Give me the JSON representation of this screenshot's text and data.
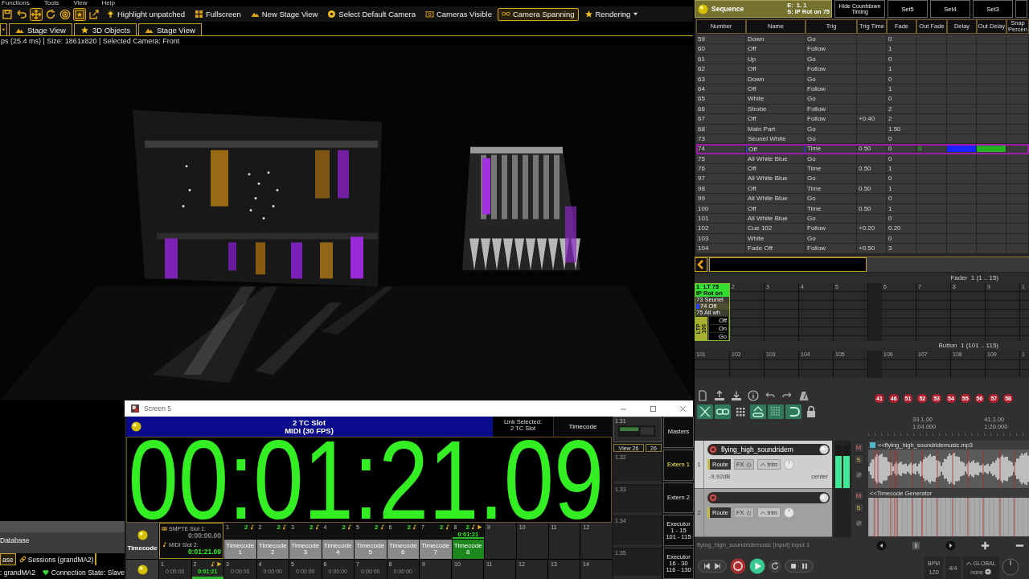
{
  "menu_bar": {
    "items": [
      "Functions",
      "Tools",
      "View",
      "Help"
    ]
  },
  "stage_toolbar": {
    "tools": [
      {
        "kind": "save",
        "selected": false
      },
      {
        "kind": "undo",
        "selected": false
      },
      {
        "kind": "move",
        "selected": true
      },
      {
        "kind": "rotate",
        "selected": false
      },
      {
        "kind": "target",
        "selected": false
      },
      {
        "kind": "star_frame",
        "selected": true
      },
      {
        "kind": "frame_arrow",
        "selected": false
      }
    ],
    "actions": [
      {
        "kind": "bulb",
        "label": "Highlight unpatched",
        "selected": false,
        "dropdown": false
      },
      {
        "kind": "grid",
        "label": "Fullscreen",
        "selected": false,
        "dropdown": false
      },
      {
        "kind": "stage",
        "label": "New Stage View",
        "selected": false,
        "dropdown": false
      },
      {
        "kind": "camera",
        "label": "Select Default Camera",
        "selected": false,
        "dropdown": false
      },
      {
        "kind": "camera_frame",
        "label": "Cameras Visible",
        "selected": false,
        "dropdown": false
      },
      {
        "kind": "glasses",
        "label": "Camera Spanning",
        "selected": true,
        "dropdown": false
      },
      {
        "kind": "star",
        "label": "Rendering",
        "selected": false,
        "dropdown": true
      }
    ]
  },
  "stage_tabs": [
    {
      "kind": "stage",
      "label": "Stage View"
    },
    {
      "kind": "star",
      "label": "3D Objects"
    },
    {
      "kind": "stage",
      "label": "Stage View"
    }
  ],
  "stage_status": "ps (25.4 ms) | Size: 1861x820 | Selected Camera: Front",
  "onpc": {
    "database": "Database",
    "tabs": [
      {
        "label": "ase",
        "selected": true
      },
      {
        "label": "Sessions (grandMA2)",
        "selected": false
      }
    ],
    "session": ": grandMA2",
    "connection": "Connection State: Slave"
  },
  "timecode_window": {
    "title": "Screen 5",
    "slot": "2 TC Slot",
    "format": "MIDI (30 FPS)",
    "link_label": "Link Selected:\n2 TC Slot",
    "view_button": "Timecode",
    "display": "00:01:21.09",
    "preview": {
      "number": "1.31",
      "view": "View 26",
      "view_number": "26"
    },
    "empty_views": [
      "1.32",
      "1.33",
      "1.34",
      "1.35"
    ],
    "side_buttons": [
      {
        "label": "Masters",
        "selected": false
      },
      {
        "label": "Extern 1",
        "selected": true
      },
      {
        "label": "Extern 2",
        "selected": false
      },
      {
        "label": "Executor\n1 - 15\n101 - 115",
        "selected": false
      },
      {
        "label": "Executor\n16 - 30\n116 - 130",
        "selected": false
      }
    ],
    "pool_button": "Timecode",
    "slot_info": [
      {
        "kind": "smpte",
        "label": "SMPTE Slot 1:",
        "value": "0:00:00.00",
        "active": false
      },
      {
        "kind": "midi",
        "label": "MIDI Slot 2:",
        "value": "0:01:21.09",
        "active": true
      }
    ],
    "timecodes": [
      {
        "number": "1",
        "slot": "2",
        "label": "Timecode\n1",
        "selected": false,
        "running": false
      },
      {
        "number": "2",
        "slot": "2",
        "label": "Timecode\n2",
        "selected": false,
        "running": false
      },
      {
        "number": "3",
        "slot": "2",
        "label": "Timecode\n3",
        "selected": false,
        "running": false
      },
      {
        "number": "4",
        "slot": "2",
        "label": "Timecode\n4",
        "selected": false,
        "running": false
      },
      {
        "number": "5",
        "slot": "2",
        "label": "Timecode\n5",
        "selected": false,
        "running": false
      },
      {
        "number": "6",
        "slot": "2",
        "label": "Timecode\n6",
        "selected": false,
        "running": false
      },
      {
        "number": "7",
        "slot": "2",
        "label": "Timecode\n7",
        "selected": false,
        "running": false
      },
      {
        "number": "8",
        "slot": "2",
        "label": "Timecode\n8",
        "selected": true,
        "running": true,
        "time": "0:01:21"
      }
    ],
    "empty_pool": [
      "9",
      "10",
      "11",
      "12"
    ],
    "executor_row": [
      {
        "number": "1",
        "time": "0:00:00",
        "running": false
      },
      {
        "number": "2",
        "time": "0:01:21",
        "running": true
      },
      {
        "number": "3",
        "time": "0:00:00",
        "running": false
      },
      {
        "number": "4",
        "time": "0:00:00",
        "running": false
      },
      {
        "number": "5",
        "time": "0:00:00",
        "running": false
      },
      {
        "number": "6",
        "time": "0:00:00",
        "running": false
      },
      {
        "number": "7",
        "time": "0:00:00",
        "running": false
      },
      {
        "number": "8",
        "time": "0:00:00",
        "running": false
      }
    ],
    "empty_executors": [
      "9",
      "10",
      "11",
      "12",
      "13",
      "14"
    ]
  },
  "sequence": {
    "title": "Sequence",
    "executor": "E:  1. 1",
    "cue": "S: IP Rot on 75",
    "buttons": [
      "Hide Countdown Timing",
      "Set5",
      "Set4",
      "Set3"
    ],
    "columns": [
      "Number",
      "Name",
      "Trig",
      "Trig Time",
      "Fade",
      "Out Fade",
      "Delay",
      "Out Delay",
      "Snap Percen"
    ],
    "rows": [
      {
        "number": "59",
        "name": "Down",
        "trig": "Go",
        "fade": "0",
        "selected": false
      },
      {
        "number": "60",
        "name": "Off",
        "trig": "Follow",
        "fade": "1",
        "selected": false
      },
      {
        "number": "61",
        "name": "Up",
        "trig": "Go",
        "fade": "0",
        "selected": false
      },
      {
        "number": "62",
        "name": "Off",
        "trig": "Follow",
        "fade": "1",
        "selected": false
      },
      {
        "number": "63",
        "name": "Down",
        "trig": "Go",
        "fade": "0",
        "selected": false
      },
      {
        "number": "64",
        "name": "Off",
        "trig": "Follow",
        "fade": "1",
        "selected": false
      },
      {
        "number": "65",
        "name": "White",
        "trig": "Go",
        "fade": "0",
        "selected": false
      },
      {
        "number": "66",
        "name": "Strobe",
        "trig": "Follow",
        "fade": "2",
        "selected": false
      },
      {
        "number": "67",
        "name": "Off",
        "trig": "Follow",
        "trig_time": "+0.40",
        "fade": "2",
        "selected": false
      },
      {
        "number": "68",
        "name": "Main Part",
        "trig": "Go",
        "fade": "1.50",
        "selected": false
      },
      {
        "number": "73",
        "name": "Seunel White",
        "trig": "Go",
        "fade": "0",
        "selected": false
      },
      {
        "number": "74",
        "name": "Off",
        "trig": "Time",
        "trig_time": "0.50",
        "fade": "0",
        "out_fade": "0",
        "delay_progress": {
          "level": 1
        },
        "out_delay_progress": {
          "level": 1
        },
        "selected": true
      },
      {
        "number": "75",
        "name": "All White Blue",
        "trig": "Go",
        "fade": "0",
        "selected": false
      },
      {
        "number": "76",
        "name": "Off",
        "trig": "Time",
        "trig_time": "0.50",
        "fade": "1",
        "selected": false
      },
      {
        "number": "97",
        "name": "All White Blue",
        "trig": "Go",
        "fade": "0",
        "selected": false
      },
      {
        "number": "98",
        "name": "Off",
        "trig": "Time",
        "trig_time": "0.50",
        "fade": "1",
        "selected": false
      },
      {
        "number": "99",
        "name": "All White Blue",
        "trig": "Go",
        "fade": "0",
        "selected": false
      },
      {
        "number": "100",
        "name": "Off",
        "trig": "Time",
        "trig_time": "0.50",
        "fade": "1",
        "selected": false
      },
      {
        "number": "101",
        "name": "All White Blue",
        "trig": "Go",
        "fade": "0",
        "selected": false
      },
      {
        "number": "102",
        "name": "Cue 102",
        "trig": "Follow",
        "trig_time": "+0.20",
        "fade": "0.20",
        "selected": false
      },
      {
        "number": "103",
        "name": "White",
        "trig": "Go",
        "fade": "0",
        "selected": false
      },
      {
        "number": "104",
        "name": "Fade Off",
        "trig": "Follow",
        "trig_time": "+0.50",
        "fade": "3",
        "selected": false
      }
    ]
  },
  "fader_bar": {
    "title": "Fader  1 (1 .. 15)",
    "executors": [
      {
        "kind": "sequence",
        "number": "1",
        "label": "LT 75",
        "name": "IP Rot on",
        "cues": [
          {
            "label": "73 Seunel",
            "current": false
          },
          {
            "label": "74 Off",
            "current": true
          },
          {
            "label": "75 All wh",
            "current": false
          }
        ],
        "master": "LTP\n100",
        "buttons": [
          "Off",
          "On",
          "Go"
        ]
      },
      {
        "kind": "empty",
        "number": "2"
      },
      {
        "kind": "empty",
        "number": "3"
      },
      {
        "kind": "empty",
        "number": "4"
      },
      {
        "kind": "empty",
        "number": "5"
      },
      {
        "kind": "empty",
        "number": "6"
      },
      {
        "kind": "empty",
        "number": "7"
      },
      {
        "kind": "empty",
        "number": "8"
      },
      {
        "kind": "empty",
        "number": "9"
      },
      {
        "kind": "empty",
        "number": "1"
      }
    ]
  },
  "button_bar": {
    "title": "Button  1 (101 .. 115)",
    "slots": [
      "101",
      "102",
      "103",
      "104",
      "105",
      "106",
      "107",
      "108",
      "109",
      "1"
    ]
  },
  "reaper": {
    "toggles": [
      {
        "kind": "crossfade",
        "on": true
      },
      {
        "kind": "link",
        "on": true
      },
      {
        "kind": "grid_dots",
        "on": false
      },
      {
        "kind": "envelope",
        "on": true
      },
      {
        "kind": "grid_lines",
        "on": true
      },
      {
        "kind": "loop",
        "on": true
      },
      {
        "kind": "lock",
        "on": false
      }
    ],
    "markers": [
      "41",
      "46",
      "51",
      "52",
      "53",
      "54",
      "55",
      "56",
      "57",
      "58"
    ],
    "ruler": [
      {
        "bar": "33.1.00",
        "time": "1:04.000"
      },
      {
        "bar": "41.1.00",
        "time": "1:20.000"
      }
    ],
    "tracks": [
      {
        "number": "1",
        "name": "flying_high_soundridem",
        "volume": "-9.92dB",
        "pan": "center",
        "selected": true,
        "route": "Route",
        "fx": "FX",
        "trim": "trim",
        "mute": "M",
        "solo": "S",
        "meters": [
          {
            "level": 0.75
          },
          {
            "level": 0.75
          }
        ]
      },
      {
        "number": "2",
        "selected": false,
        "route": "Route",
        "fx": "FX",
        "trim": "trim",
        "mute": "M",
        "solo": "S"
      }
    ],
    "items": [
      {
        "kind": "audio",
        "name": "<<flying_high_soundridemusic.mp3"
      },
      {
        "kind": "generator",
        "name": "<<Timecode Generator"
      }
    ],
    "status": "flying_high_soundridemusic [input] Input 1",
    "transport": {
      "playing": true
    },
    "bpm_label": "BPM",
    "bpm": "120",
    "time_signature": "4/4",
    "automation_label": "GLOBAL",
    "automation_mode": "none"
  }
}
